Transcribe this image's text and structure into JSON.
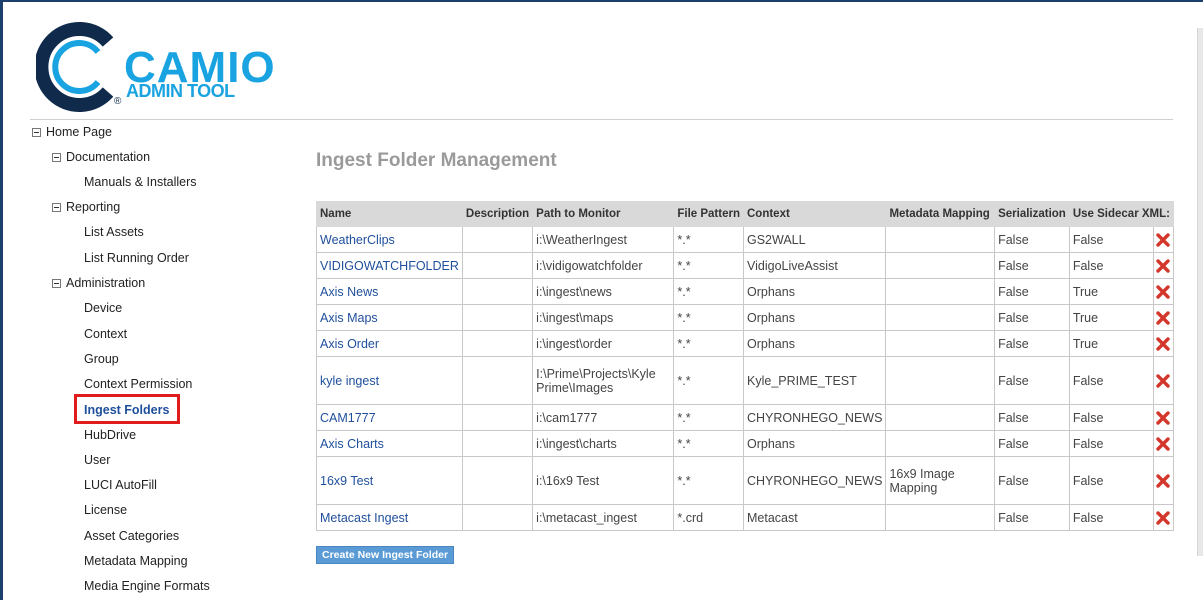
{
  "app": {
    "logo_title": "CAMIO",
    "logo_subtitle": "ADMIN TOOL",
    "registered_mark": "®"
  },
  "tree": {
    "root": "Home Page",
    "sections": [
      {
        "label": "Documentation",
        "items": [
          "Manuals & Installers"
        ]
      },
      {
        "label": "Reporting",
        "items": [
          "List Assets",
          "List Running Order"
        ]
      },
      {
        "label": "Administration",
        "items": [
          "Device",
          "Context",
          "Group",
          "Context Permission",
          "Ingest Folders",
          "HubDrive",
          "User",
          "LUCI AutoFill",
          "License",
          "Asset Categories",
          "Metadata Mapping",
          "Media Engine Formats"
        ]
      }
    ],
    "active_item": "Ingest Folders"
  },
  "main": {
    "title": "Ingest Folder Management",
    "columns": [
      "Name",
      "Description",
      "Path to Monitor",
      "File Pattern",
      "Context",
      "Metadata Mapping",
      "Serialization",
      "Use Sidecar XML:"
    ],
    "rows": [
      {
        "name": "WeatherClips",
        "description": "",
        "path": "i:\\WeatherIngest",
        "pattern": "*.*",
        "context": "GS2WALL",
        "mapping": "",
        "serialization": "False",
        "sidecar": "False"
      },
      {
        "name": "VIDIGOWATCHFOLDER",
        "description": "",
        "path": "i:\\vidigowatchfolder",
        "pattern": "*.*",
        "context": "VidigoLiveAssist",
        "mapping": "",
        "serialization": "False",
        "sidecar": "False"
      },
      {
        "name": "Axis News",
        "description": "",
        "path": "i:\\ingest\\news",
        "pattern": "*.*",
        "context": "Orphans",
        "mapping": "",
        "serialization": "False",
        "sidecar": "True"
      },
      {
        "name": "Axis Maps",
        "description": "",
        "path": "i:\\ingest\\maps",
        "pattern": "*.*",
        "context": "Orphans",
        "mapping": "",
        "serialization": "False",
        "sidecar": "True"
      },
      {
        "name": "Axis Order",
        "description": "",
        "path": "i:\\ingest\\order",
        "pattern": "*.*",
        "context": "Orphans",
        "mapping": "",
        "serialization": "False",
        "sidecar": "True"
      },
      {
        "name": "kyle ingest",
        "description": "",
        "path": "I:\\Prime\\Projects\\Kyle Prime\\Images",
        "pattern": "*.*",
        "context": "Kyle_PRIME_TEST",
        "mapping": "",
        "serialization": "False",
        "sidecar": "False"
      },
      {
        "name": "CAM1777",
        "description": "",
        "path": "i:\\cam1777",
        "pattern": "*.*",
        "context": "CHYRONHEGO_NEWS",
        "mapping": "",
        "serialization": "False",
        "sidecar": "False"
      },
      {
        "name": "Axis Charts",
        "description": "",
        "path": "i:\\ingest\\charts",
        "pattern": "*.*",
        "context": "Orphans",
        "mapping": "",
        "serialization": "False",
        "sidecar": "False"
      },
      {
        "name": "16x9 Test",
        "description": "",
        "path": "i:\\16x9 Test",
        "pattern": "*.*",
        "context": "CHYRONHEGO_NEWS",
        "mapping": "16x9 Image Mapping",
        "serialization": "False",
        "sidecar": "False"
      },
      {
        "name": "Metacast Ingest",
        "description": "",
        "path": "i:\\metacast_ingest",
        "pattern": "*.crd",
        "context": "Metacast",
        "mapping": "",
        "serialization": "False",
        "sidecar": "False"
      }
    ],
    "create_button": "Create New Ingest Folder"
  },
  "colors": {
    "brand": "#19a3e0",
    "link": "#1f4f9c",
    "highlight_box": "#e01b1b",
    "delete_icon": "#d3362a",
    "button": "#5b9bd5",
    "header_bg": "#d9d9d9"
  },
  "icons": {
    "tree_toggle": "collapse-minus-icon",
    "delete": "delete-x-icon"
  }
}
